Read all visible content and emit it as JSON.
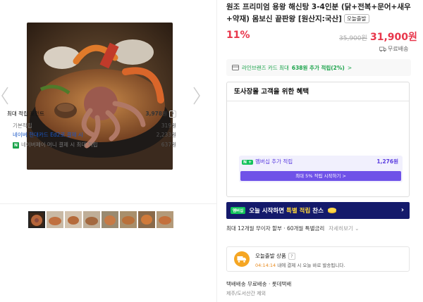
{
  "product": {
    "title": "원조 프리미엄 용왕 해신탕 3-4인분 (닭+전복+문어+새우+약재) 몸보신 끝판왕 [원산지:국산]",
    "badge": "오늘출발",
    "discount": "11%",
    "original_price": "35,900원",
    "sale_price": "31,900원",
    "shipping_label": "무료배송"
  },
  "card_banner": {
    "prefix": "라인브랜즈 카드 최대",
    "bold": "638원 추가 적립(2%)",
    "suffix": ">"
  },
  "benefits": {
    "heading": "또사장몰 고객을 위한 혜택",
    "max_points_label": "최대 적립 포인트",
    "max_points_value": "3,978원",
    "basic_label": "기본적립",
    "basic_value": "319원",
    "naver_card_label": "네이버 현대카드 Ed2로 결제 시",
    "naver_card_value": "2,233원",
    "npay_label": "네이버페이 머니 결제 시 최대 적립",
    "npay_value": "637원",
    "member_label": "멤버십 추가 적립",
    "member_value": "1,276원",
    "member_button": "최대 5% 적립 시작하기 >"
  },
  "promo": {
    "badge": "멤버십",
    "text_prefix": "오늘 시작하면",
    "text_highlight": "특별 적립",
    "text_suffix": "찬스"
  },
  "installment": {
    "text": "최대 12개월 무이자 할부 · 60개월 특별금리",
    "more": "자세히보기 ⌄"
  },
  "today_ship": {
    "title": "오늘출발 상품",
    "time": "04:14:14",
    "desc_suffix": "내에 결제 시 오늘 바로 발송됩니다."
  },
  "delivery": {
    "line1": "택배배송   무료배송 · 롯데택배",
    "line2": "제주/도서산간 제외"
  },
  "colors": {
    "accent_red": "#e8364b",
    "promo_navy": "#141a6b",
    "member_purple": "#6f52e8",
    "naver_green": "#12c25a"
  },
  "icons": [
    "chevron-left-icon",
    "chevron-right-icon",
    "truck-icon",
    "card-icon",
    "question-icon"
  ]
}
